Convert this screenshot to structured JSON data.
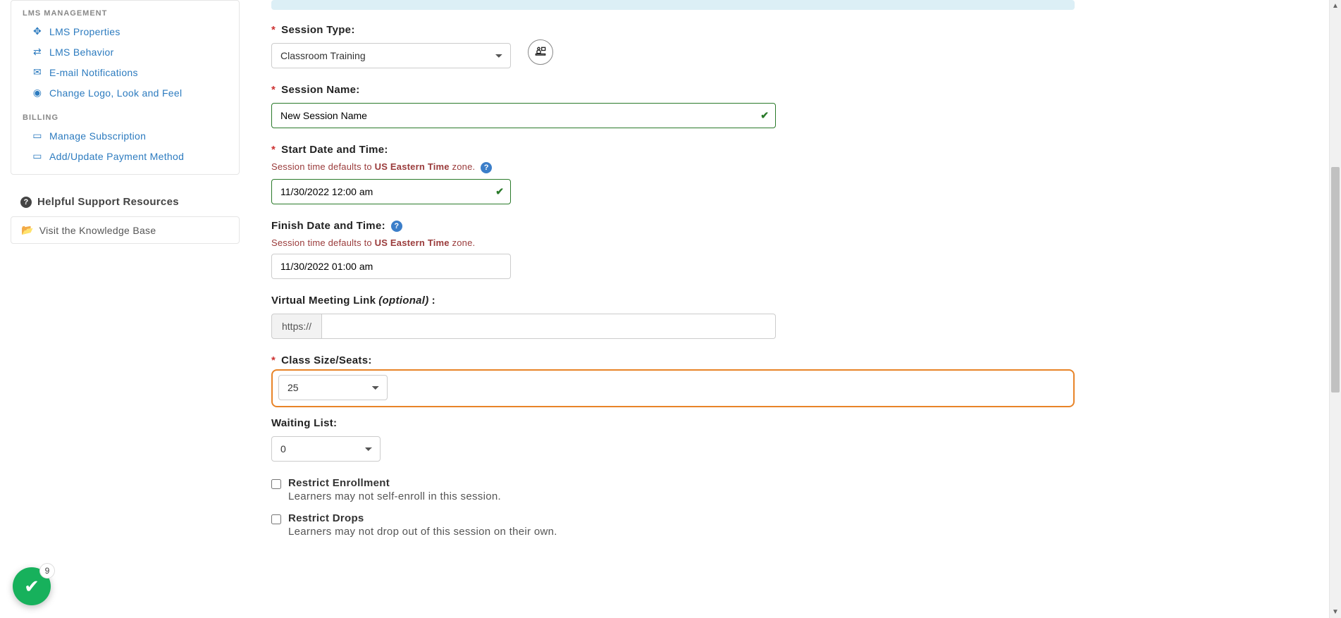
{
  "sidebar": {
    "sections": [
      {
        "heading": "LMS MANAGEMENT",
        "items": [
          {
            "icon": "✥",
            "label": "LMS Properties",
            "name": "lms-properties"
          },
          {
            "icon": "⇄",
            "label": "LMS Behavior",
            "name": "lms-behavior"
          },
          {
            "icon": "✉",
            "label": "E-mail Notifications",
            "name": "email-notifications"
          },
          {
            "icon": "●",
            "label": "Change Logo, Look and Feel",
            "name": "change-logo"
          }
        ]
      },
      {
        "heading": "BILLING",
        "items": [
          {
            "icon": "💼",
            "label": "Manage Subscription",
            "name": "manage-subscription"
          },
          {
            "icon": "💳",
            "label": "Add/Update Payment Method",
            "name": "update-payment"
          }
        ]
      }
    ],
    "support_heading": "Helpful Support Resources",
    "kb_label": "Visit the Knowledge Base"
  },
  "form": {
    "session_type": {
      "label": "Session Type:",
      "value": "Classroom Training"
    },
    "session_name": {
      "label": "Session Name:",
      "value": "New Session Name"
    },
    "start": {
      "label": "Start Date and Time:",
      "hint_prefix": "Session time defaults to ",
      "hint_tz": "US Eastern Time",
      "hint_suffix": " zone.",
      "value": "11/30/2022 12:00 am"
    },
    "finish": {
      "label": "Finish Date and Time:",
      "hint_prefix": "Session time defaults to ",
      "hint_tz": "US Eastern Time",
      "hint_suffix": " zone.",
      "value": "11/30/2022 01:00 am"
    },
    "virtual_link": {
      "label": "Virtual Meeting Link ",
      "optional": "(optional)",
      "colon": ":",
      "prefix": "https://",
      "value": ""
    },
    "class_size": {
      "label": "Class Size/Seats:",
      "value": "25"
    },
    "waiting_list": {
      "label": "Waiting List:",
      "value": "0"
    },
    "restrict_enroll": {
      "label": "Restrict Enrollment",
      "desc": "Learners may not self-enroll in this session."
    },
    "restrict_drops": {
      "label": "Restrict Drops",
      "desc": "Learners may not drop out of this session on their own."
    }
  },
  "fab": {
    "count": "9"
  }
}
